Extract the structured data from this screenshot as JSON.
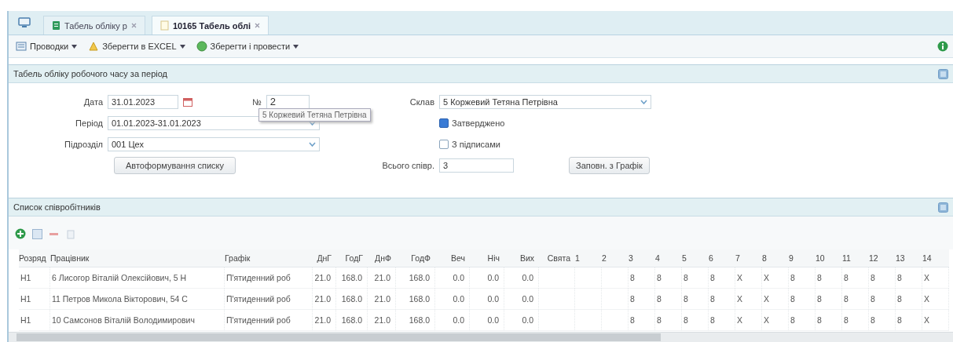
{
  "tabs": [
    {
      "label": "Табель обліку р",
      "selected": false
    },
    {
      "label": "10165 Табель облі",
      "selected": true
    }
  ],
  "toolbar": {
    "buttons": [
      {
        "label": "Проводки"
      },
      {
        "label": "Зберегти в EXCEL"
      },
      {
        "label": "Зберегти і провести"
      }
    ]
  },
  "form_panel": {
    "title": "Табель обліку робочого часу за період",
    "fields": {
      "date": {
        "label": "Дата",
        "value": "31.01.2023"
      },
      "number": {
        "label": "№",
        "value": "2"
      },
      "period": {
        "label": "Період",
        "value": "01.01.2023-31.01.2023"
      },
      "department": {
        "label": "Підрозділ",
        "value": "001 Цех"
      },
      "author": {
        "label": "Склав",
        "value": "5 Коржевий Тетяна Петрівна"
      },
      "total": {
        "label": "Всього співр.",
        "value": "3"
      }
    },
    "tooltip": "5 Коржевий Тетяна Петрівна",
    "checkboxes": [
      {
        "label": "Затверджено",
        "checked": true
      },
      {
        "label": "З підписами",
        "checked": false
      }
    ],
    "autofill_button": "Автоформування списку",
    "schedule_button": "Заповн. з Графік"
  },
  "employees_panel": {
    "title": "Список співробітників",
    "table": {
      "columns": [
        "Розряд",
        "Працівник",
        "Графік",
        "ДнГ",
        "ГодГ",
        "ДнФ",
        "ГодФ",
        "Веч",
        "Ніч",
        "Вих",
        "Свята",
        "1",
        "2",
        "3",
        "4",
        "5",
        "6",
        "7",
        "8",
        "9",
        "10",
        "11",
        "12",
        "13",
        "14"
      ],
      "rows": [
        {
          "cells": [
            "Н1",
            "6 Лисогор Віталій Олексійович, 5 Н",
            "П'ятиденний роб",
            "21.0",
            "168.0",
            "21.0",
            "168.0",
            "0.0",
            "0.0",
            "0.0",
            null,
            null,
            null,
            "8",
            "8",
            "8",
            "8",
            "X",
            "X",
            "8",
            "8",
            "8",
            "8",
            "8",
            "X"
          ]
        },
        {
          "cells": [
            "Н1",
            "11 Петров Микола Вікторович, 54 С",
            "П'ятиденний роб",
            "21.0",
            "168.0",
            "21.0",
            "168.0",
            "0.0",
            "0.0",
            "0.0",
            null,
            null,
            null,
            "8",
            "8",
            "8",
            "8",
            "X",
            "X",
            "8",
            "8",
            "8",
            "8",
            "8",
            "X"
          ]
        },
        {
          "cells": [
            "Н1",
            "10 Самсонов Віталій Володимирович",
            "П'ятиденний роб",
            "21.0",
            "168.0",
            "21.0",
            "168.0",
            "0.0",
            "0.0",
            "0.0",
            null,
            null,
            null,
            "8",
            "8",
            "8",
            "8",
            "X",
            "X",
            "8",
            "8",
            "8",
            "8",
            "8",
            "X"
          ]
        }
      ]
    }
  }
}
